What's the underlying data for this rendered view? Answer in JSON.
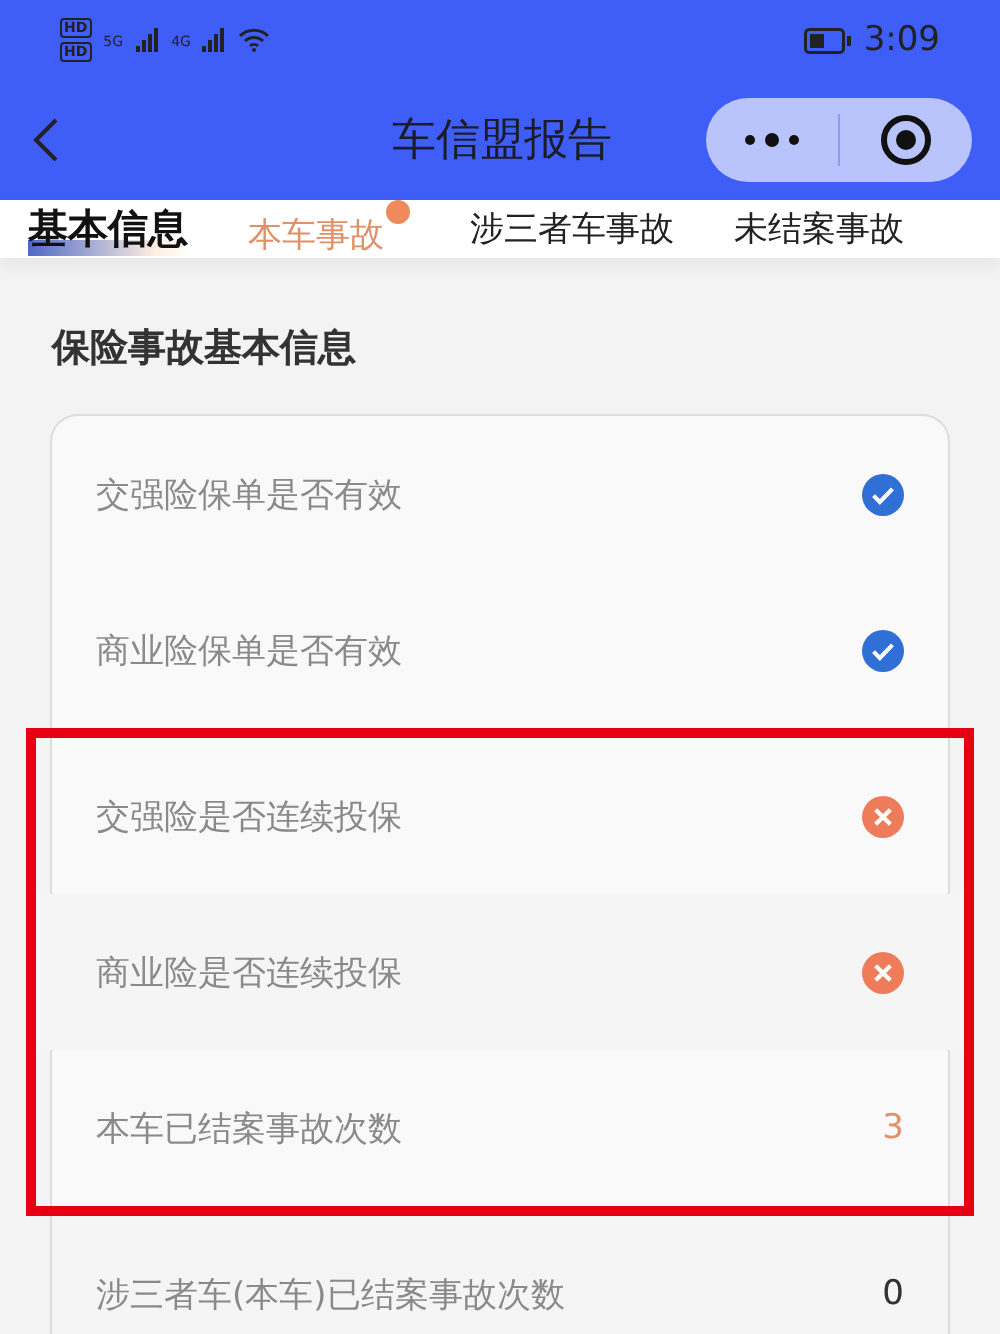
{
  "status_bar": {
    "hd_badges": [
      "HD",
      "HD"
    ],
    "networks": [
      "5G",
      "4G"
    ],
    "time": "3:09"
  },
  "nav": {
    "title": "车信盟报告"
  },
  "tabs": [
    {
      "label": "基本信息",
      "selected": true,
      "alert": false
    },
    {
      "label": "本车事故",
      "selected": false,
      "alert": true
    },
    {
      "label": "涉三者车事故",
      "selected": false,
      "alert": false
    },
    {
      "label": "未结案事故",
      "selected": false,
      "alert": false
    }
  ],
  "section": {
    "title": "保险事故基本信息"
  },
  "rows": [
    {
      "label": "交强险保单是否有效",
      "kind": "flag",
      "ok": true,
      "highlighted": false
    },
    {
      "label": "商业险保单是否有效",
      "kind": "flag",
      "ok": true,
      "highlighted": false
    },
    {
      "label": "交强险是否连续投保",
      "kind": "flag",
      "ok": false,
      "highlighted": true
    },
    {
      "label": "商业险是否连续投保",
      "kind": "flag",
      "ok": false,
      "highlighted": true
    },
    {
      "label": "本车已结案事故次数",
      "kind": "count",
      "value": "3",
      "alert": true,
      "highlighted": true
    },
    {
      "label": "涉三者车(本车)已结案事故次数",
      "kind": "count",
      "value": "0",
      "alert": false,
      "highlighted": false
    }
  ]
}
